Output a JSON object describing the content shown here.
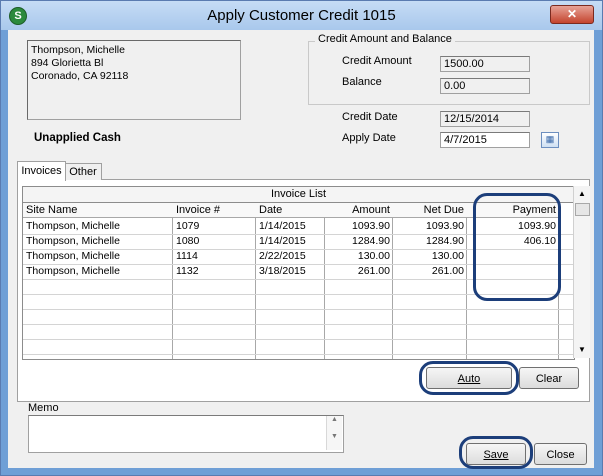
{
  "window": {
    "title": "Apply Customer Credit 1015",
    "close_glyph": "✕"
  },
  "address": {
    "lines": [
      "Thompson, Michelle",
      "894 Glorietta Bl",
      "Coronado, CA  92118"
    ]
  },
  "credit_group": {
    "title": "Credit Amount and Balance",
    "credit_amount_label": "Credit Amount",
    "credit_amount_value": "1500.00",
    "balance_label": "Balance",
    "balance_value": "0.00"
  },
  "credit_date": {
    "label": "Credit Date",
    "value": "12/15/2014"
  },
  "apply_date": {
    "label": "Apply Date",
    "value": "4/7/2015"
  },
  "unapplied_cash_label": "Unapplied Cash",
  "tabs": [
    {
      "label": "Invoices"
    },
    {
      "label": "Other"
    }
  ],
  "invoice_list": {
    "caption": "Invoice List",
    "columns": [
      "Site Name",
      "Invoice #",
      "Date",
      "Amount",
      "Net Due",
      "Payment"
    ],
    "rows": [
      [
        "Thompson, Michelle",
        "1079",
        "1/14/2015",
        "1093.90",
        "1093.90",
        "1093.90"
      ],
      [
        "Thompson, Michelle",
        "1080",
        "1/14/2015",
        "1284.90",
        "1284.90",
        "406.10"
      ],
      [
        "Thompson, Michelle",
        "1114",
        "2/22/2015",
        "130.00",
        "130.00",
        ""
      ],
      [
        "Thompson, Michelle",
        "1132",
        "3/18/2015",
        "261.00",
        "261.00",
        ""
      ]
    ]
  },
  "buttons": {
    "auto": "Auto",
    "clear": "Clear",
    "save": "Save",
    "close": "Close"
  },
  "memo": {
    "label": "Memo",
    "value": ""
  },
  "icons": {
    "app": "app-logo-icon",
    "calendar": "calendar-icon"
  },
  "colors": {
    "highlight_oval": "#1c3e7a",
    "title_bar": "#a9c8ec"
  }
}
